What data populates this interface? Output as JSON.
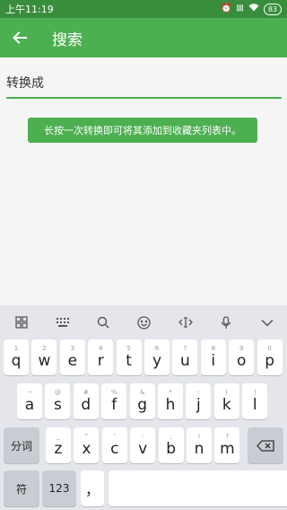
{
  "status_bar": {
    "time": "上午11:19",
    "battery": "83"
  },
  "app_bar": {
    "title": "搜索"
  },
  "search": {
    "value": "转换成",
    "placeholder": "转换成"
  },
  "toast": {
    "message": "长按一次转换即可将其添加到收藏夹列表中。"
  },
  "keyboard": {
    "toolbar": [
      "grid-icon",
      "keyboard-icon",
      "search-icon",
      "emoji-icon",
      "cursor-icon",
      "mic-icon",
      "collapse-icon"
    ],
    "row1": [
      {
        "hint": "1",
        "ch": "q"
      },
      {
        "hint": "2",
        "ch": "w"
      },
      {
        "hint": "3",
        "ch": "e"
      },
      {
        "hint": "4",
        "ch": "r"
      },
      {
        "hint": "5",
        "ch": "t"
      },
      {
        "hint": "6",
        "ch": "y"
      },
      {
        "hint": "7",
        "ch": "u"
      },
      {
        "hint": "8",
        "ch": "i"
      },
      {
        "hint": "9",
        "ch": "o"
      },
      {
        "hint": "0",
        "ch": "p"
      }
    ],
    "row2": [
      {
        "hint": "~",
        "ch": "a"
      },
      {
        "hint": "@",
        "ch": "s"
      },
      {
        "hint": "#",
        "ch": "d"
      },
      {
        "hint": "%",
        "ch": "f"
      },
      {
        "hint": "&",
        "ch": "g"
      },
      {
        "hint": "*",
        "ch": "h"
      },
      {
        "hint": "-",
        "ch": "j"
      },
      {
        "hint": "(",
        "ch": "k"
      },
      {
        "hint": ")",
        "ch": "l"
      }
    ],
    "row3": [
      {
        "hint": "_",
        "ch": "z"
      },
      {
        "hint": "\"",
        "ch": "x"
      },
      {
        "hint": "'",
        "ch": "c"
      },
      {
        "hint": ":",
        "ch": "v"
      },
      {
        "hint": ";",
        "ch": "b"
      },
      {
        "hint": "!",
        "ch": "n"
      },
      {
        "hint": "?",
        "ch": "m"
      }
    ],
    "fenci": "分词",
    "symbol": "符",
    "num": "123",
    "comma": "，"
  }
}
